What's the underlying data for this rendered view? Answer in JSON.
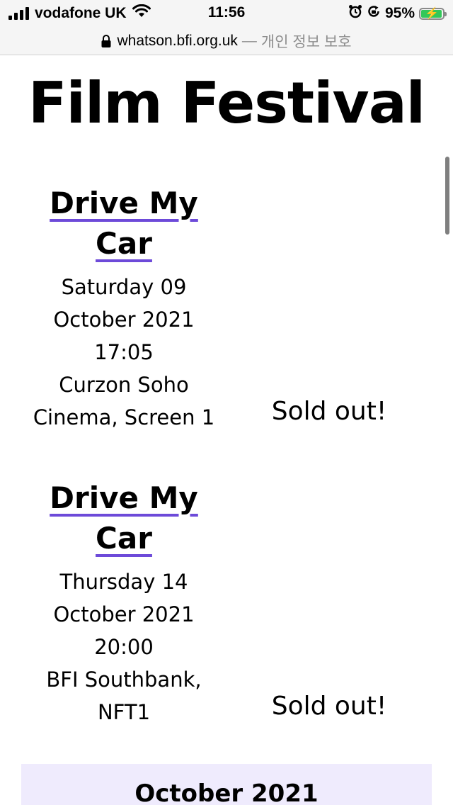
{
  "status_bar": {
    "carrier": "vodafone UK",
    "time": "11:56",
    "battery_percent": "95%",
    "battery_level": 0.95,
    "battery_color": "#33c759",
    "icons": [
      "signal-icon",
      "wifi-icon",
      "alarm-icon",
      "orientation-lock-icon",
      "battery-icon"
    ]
  },
  "browser": {
    "url_host": "whatson.bfi.org.uk",
    "separator": "—",
    "privacy_label": "개인 정보 보호"
  },
  "page": {
    "title": "Film Festival",
    "accent_color": "#6d4ad9",
    "month_header_bg": "#efebfd"
  },
  "screenings": [
    {
      "film_title": "Drive My Car",
      "day": "Saturday 09",
      "month_year": "October 2021",
      "time": "17:05",
      "venue_line1": "Curzon Soho",
      "venue_line2": "Cinema, Screen 1",
      "availability": "Sold out!"
    },
    {
      "film_title": "Drive My Car",
      "day": "Thursday 14",
      "month_year": "October 2021",
      "time": "20:00",
      "venue_line1": "BFI Southbank,",
      "venue_line2": "NFT1",
      "availability": "Sold out!"
    }
  ],
  "month_header": {
    "label": "October 2021"
  }
}
